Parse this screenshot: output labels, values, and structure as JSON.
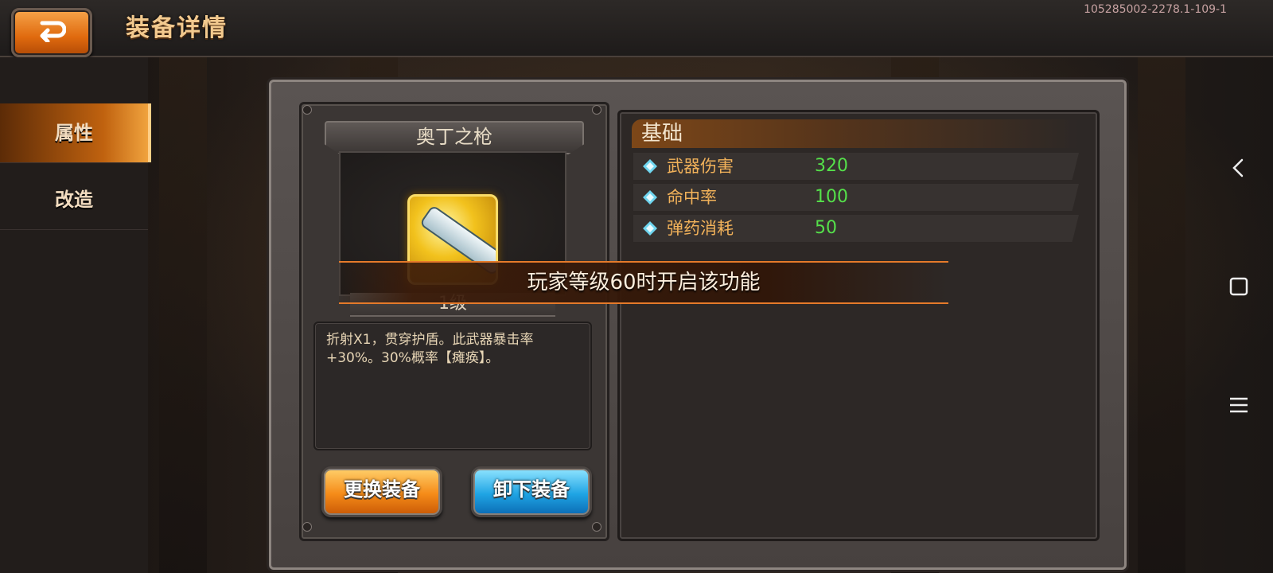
{
  "header": {
    "title": "装备详情",
    "build_id": "105285002-2278.1-109-1"
  },
  "sidenav": {
    "items": [
      {
        "label": "属性",
        "active": true
      },
      {
        "label": "改造",
        "active": false
      }
    ]
  },
  "item": {
    "name": "奥丁之枪",
    "level": "1级",
    "description": "折射X1，贯穿护盾。此武器暴击率+30%。30%概率【瘫痪】。"
  },
  "buttons": {
    "change": "更换装备",
    "unequip": "卸下装备"
  },
  "stats": {
    "section_title": "基础",
    "rows": [
      {
        "label": "武器伤害",
        "value": "320"
      },
      {
        "label": "命中率",
        "value": "100"
      },
      {
        "label": "弹药消耗",
        "value": "50"
      }
    ]
  },
  "toast": "玩家等级60时开启该功能",
  "colors": {
    "accent_orange": "#e57a2a",
    "stat_value_green": "#55e04a",
    "stat_label_gold": "#f2b25a"
  },
  "icons": {
    "back": "back-arrow-icon",
    "stat_bullet": "diamond-bullet-icon",
    "system_nav": [
      "back-chevron-icon",
      "recents-square-icon",
      "menu-lines-icon"
    ]
  }
}
